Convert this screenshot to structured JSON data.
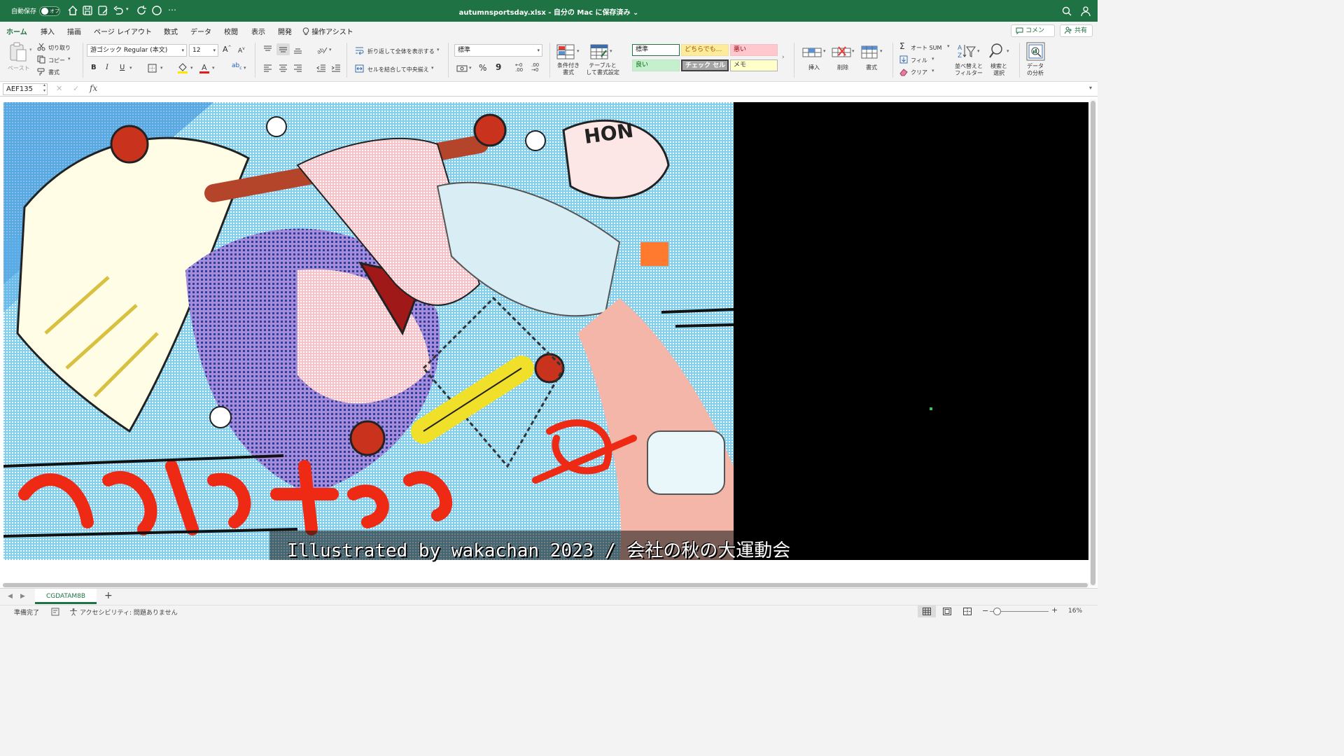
{
  "titlebar": {
    "autosave_label": "自動保存",
    "autosave_state": "オフ",
    "document_title": "autumnsportsday.xlsx - 自分の Mac に保存済み"
  },
  "tabs": [
    "ホーム",
    "挿入",
    "描画",
    "ページ レイアウト",
    "数式",
    "データ",
    "校閲",
    "表示",
    "開発",
    "操作アシスト"
  ],
  "topbar": {
    "comment_label": "コメント",
    "share_label": "共有"
  },
  "ribbon": {
    "paste_label": "ペースト",
    "cut_label": "切り取り",
    "copy_label": "コピー",
    "format_painter_label": "書式",
    "font_name": "游ゴシック Regular (本文)",
    "font_size": "12",
    "bold": "B",
    "italic": "I",
    "underline": "U",
    "wrap_text_label": "折り返して全体を表示する",
    "merge_center_label": "セルを結合して中央揃え",
    "number_format": "標準",
    "percent": "%",
    "comma": "9",
    "cond_format_label_1": "条件付き",
    "cond_format_label_2": "書式",
    "table_format_label_1": "テーブルと",
    "table_format_label_2": "して書式設定",
    "styles": {
      "normal": "標準",
      "neutral": "どちらでも...",
      "bad": "悪い",
      "good": "良い",
      "check_cell": "チェック セル",
      "note": "メモ"
    },
    "insert_label": "挿入",
    "delete_label": "削除",
    "format_label": "書式",
    "autosum_label": "オート SUM",
    "fill_label": "フィル",
    "clear_label": "クリア",
    "sort_filter_label_1": "並べ替えと",
    "sort_filter_label_2": "フィルター",
    "find_select_label_1": "検索と",
    "find_select_label_2": "選択",
    "analyze_label_1": "データ",
    "analyze_label_2": "の分析"
  },
  "formula_bar": {
    "name_box": "AEF135",
    "fx": "fx",
    "value": ""
  },
  "sheet": {
    "credit_text": "Illustrated by wakachan 2023 / 会社の秋の大運動会"
  },
  "sheet_tabs": [
    "CGDATAM8B"
  ],
  "statusbar": {
    "ready": "準備完了",
    "accessibility": "アクセシビリティ: 問題ありません",
    "zoom": "16%"
  },
  "colors": {
    "accent": "#1f7244",
    "sheet_background": "#000000",
    "style_neutral_bg": "#ffeb9c",
    "style_bad_bg": "#ffc7ce",
    "style_good_bg": "#c6efce",
    "style_check_bg": "#a5a5a5",
    "style_note_bg": "#ffffcc"
  },
  "icons": [
    "home-icon",
    "save-icon",
    "save-as-icon",
    "undo-icon",
    "redo-icon",
    "circle-icon",
    "more-icon",
    "search-icon",
    "account-icon"
  ]
}
